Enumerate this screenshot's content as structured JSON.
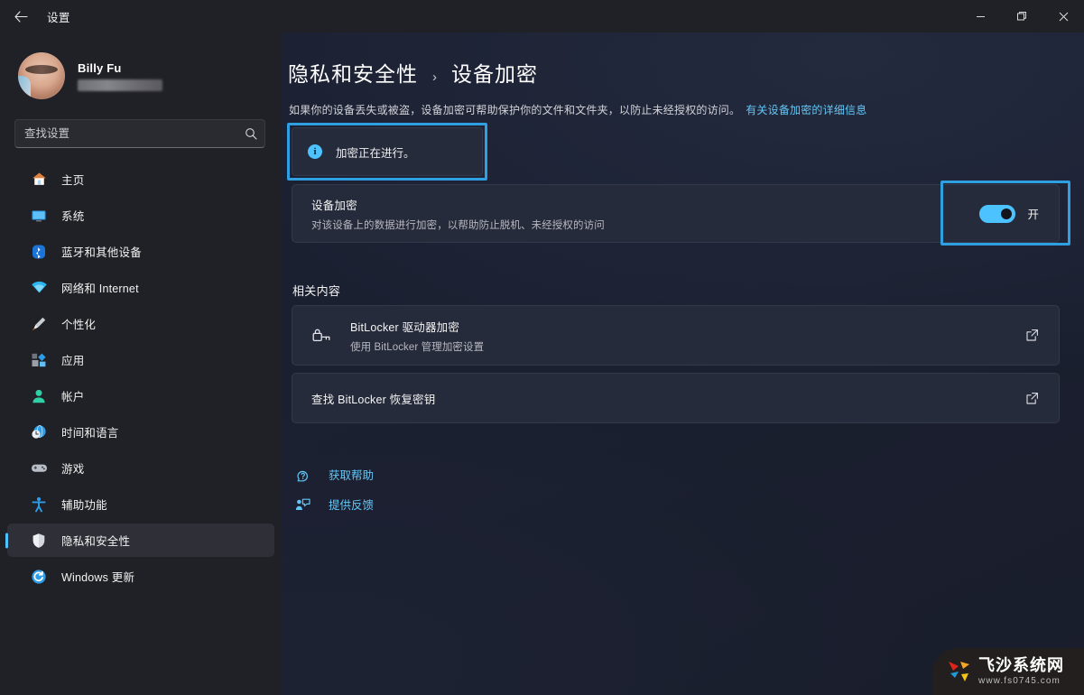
{
  "window": {
    "title": "设置",
    "back_icon": "arrow-left-icon",
    "controls": {
      "minimize": "minimize-icon",
      "maximize": "maximize-icon",
      "close": "close-icon"
    }
  },
  "sidebar": {
    "profile": {
      "name": "Billy Fu",
      "email_redacted": ""
    },
    "search": {
      "placeholder": "查找设置",
      "value": "",
      "icon": "search-icon"
    },
    "items": [
      {
        "label": "主页",
        "icon": "home-icon",
        "active": false
      },
      {
        "label": "系统",
        "icon": "system-monitor-icon",
        "active": false
      },
      {
        "label": "蓝牙和其他设备",
        "icon": "bluetooth-icon",
        "active": false
      },
      {
        "label": "网络和 Internet",
        "icon": "wifi-icon",
        "active": false
      },
      {
        "label": "个性化",
        "icon": "paintbrush-icon",
        "active": false
      },
      {
        "label": "应用",
        "icon": "apps-icon",
        "active": false
      },
      {
        "label": "帐户",
        "icon": "account-person-icon",
        "active": false
      },
      {
        "label": "时间和语言",
        "icon": "clock-globe-icon",
        "active": false
      },
      {
        "label": "游戏",
        "icon": "gamepad-icon",
        "active": false
      },
      {
        "label": "辅助功能",
        "icon": "accessibility-person-icon",
        "active": false
      },
      {
        "label": "隐私和安全性",
        "icon": "shield-icon",
        "active": true
      },
      {
        "label": "Windows 更新",
        "icon": "update-refresh-icon",
        "active": false
      }
    ]
  },
  "main": {
    "breadcrumb": {
      "parent": "隐私和安全性",
      "separator": "›",
      "current": "设备加密"
    },
    "description": {
      "text": "如果你的设备丢失或被盗，设备加密可帮助保护你的文件和文件夹，以防止未经授权的访问。",
      "link": "有关设备加密的详细信息"
    },
    "banner": {
      "icon": "info-icon",
      "icon_glyph": "i",
      "text": "加密正在进行。"
    },
    "encryption_row": {
      "title": "设备加密",
      "subtitle": "对该设备上的数据进行加密，以帮助防止脱机、未经授权的访问",
      "toggle_state": "开",
      "toggle_on": true
    },
    "related": {
      "section_title": "相关内容",
      "rows": [
        {
          "icon": "padlock-key-icon",
          "title": "BitLocker 驱动器加密",
          "subtitle": "使用 BitLocker 管理加密设置",
          "action_icon": "external-link-icon"
        },
        {
          "icon": "",
          "title": "查找 BitLocker 恢复密钥",
          "subtitle": "",
          "action_icon": "external-link-icon"
        }
      ]
    },
    "links": [
      {
        "label": "获取帮助",
        "icon": "help-question-icon"
      },
      {
        "label": "提供反馈",
        "icon": "feedback-icon"
      }
    ]
  },
  "watermark": {
    "name": "飞沙系统网",
    "url": "www.fs0745.com"
  },
  "colors": {
    "accent": "#4cc2ff",
    "link": "#62c6f5",
    "highlight_ring": "#2e9fe0",
    "sidebar_bg": "#202027",
    "content_bg": "#1b2030",
    "card_bg": "#262b3b"
  }
}
